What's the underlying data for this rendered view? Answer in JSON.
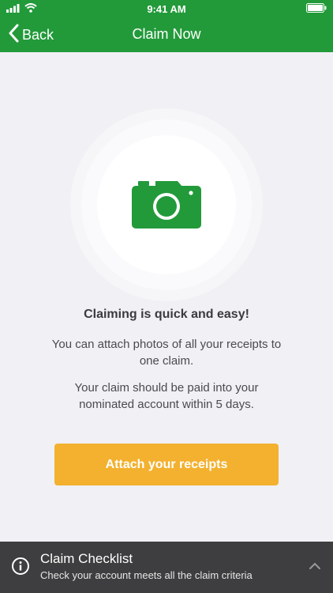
{
  "status_bar": {
    "time": "9:41 AM"
  },
  "nav": {
    "back_label": "Back",
    "title": "Claim Now"
  },
  "hero": {
    "icon": "camera-icon"
  },
  "content": {
    "heading": "Claiming is quick and easy!",
    "paragraph_1": "You can attach photos of all your receipts to one claim.",
    "paragraph_2": "Your claim should be paid into your nominated account within 5 days."
  },
  "actions": {
    "attach_label": "Attach your receipts"
  },
  "checklist": {
    "title": "Claim Checklist",
    "subtitle": "Check your account meets all the claim criteria"
  },
  "colors": {
    "brand_green": "#229a3a",
    "button_yellow": "#f3b12f",
    "footer_dark": "#3e3e40",
    "background": "#f0f0f5"
  }
}
